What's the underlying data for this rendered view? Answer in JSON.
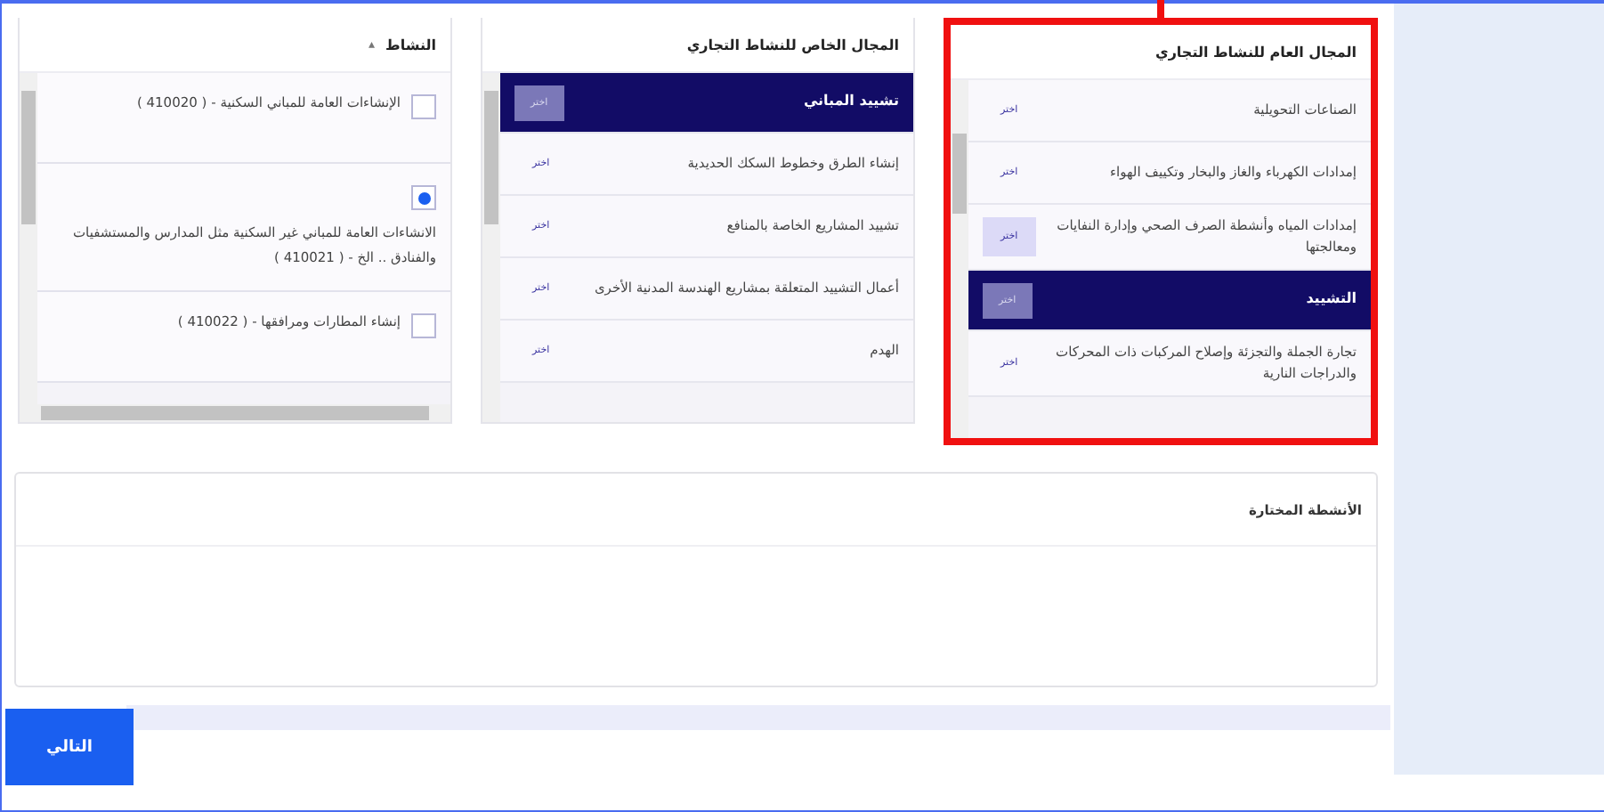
{
  "columns": [
    {
      "kind": "field",
      "title": "المجال العام للنشاط التجاري",
      "highlighted": true,
      "items": [
        {
          "label": "الصناعات التحويلية",
          "button": "اختر",
          "selected": false,
          "hovered": false
        },
        {
          "label": "إمدادات الكهرباء والغاز والبخار وتكييف الهواء",
          "button": "اختر",
          "selected": false,
          "hovered": false
        },
        {
          "label": "إمدادات المياه وأنشطة الصرف الصحي وإدارة النفايات ومعالجتها",
          "button": "اختر",
          "selected": false,
          "hovered": true
        },
        {
          "label": "التشييد",
          "button": "اختر",
          "selected": true,
          "hovered": false
        },
        {
          "label": "تجارة الجملة والتجزئة وإصلاح المركبات ذات المحركات والدراجات النارية",
          "button": "اختر",
          "selected": false,
          "hovered": false
        }
      ]
    },
    {
      "kind": "field",
      "title": "المجال الخاص للنشاط التجاري",
      "highlighted": false,
      "items": [
        {
          "label": "تشييد المباني",
          "button": "اختر",
          "selected": true,
          "hovered": false
        },
        {
          "label": "إنشاء الطرق وخطوط السكك الحديدية",
          "button": "اختر",
          "selected": false,
          "hovered": false
        },
        {
          "label": "تشييد المشاريع الخاصة بالمنافع",
          "button": "اختر",
          "selected": false,
          "hovered": false
        },
        {
          "label": "أعمال التشييد المتعلقة بمشاريع الهندسة المدنية الأخرى",
          "button": "اختر",
          "selected": false,
          "hovered": false
        },
        {
          "label": "الهدم",
          "button": "اختر",
          "selected": false,
          "hovered": false
        }
      ]
    },
    {
      "kind": "activity",
      "title": "النشاط",
      "sort_icon": "▴",
      "highlighted": false,
      "items": [
        {
          "label": "الإنشاءات العامة للمباني السكنية - ( 410020 )",
          "checked": false
        },
        {
          "label": "الانشاءات العامة للمباني غير السكنية مثل المدارس والمستشفيات والفنادق .. الخ - ( 410021 )",
          "checked": true
        },
        {
          "label": "إنشاء المطارات ومرافقها - ( 410022 )",
          "checked": false
        }
      ]
    }
  ],
  "selected_activities": {
    "title": "الأنشطة المختارة"
  },
  "next_button": "التالي"
}
